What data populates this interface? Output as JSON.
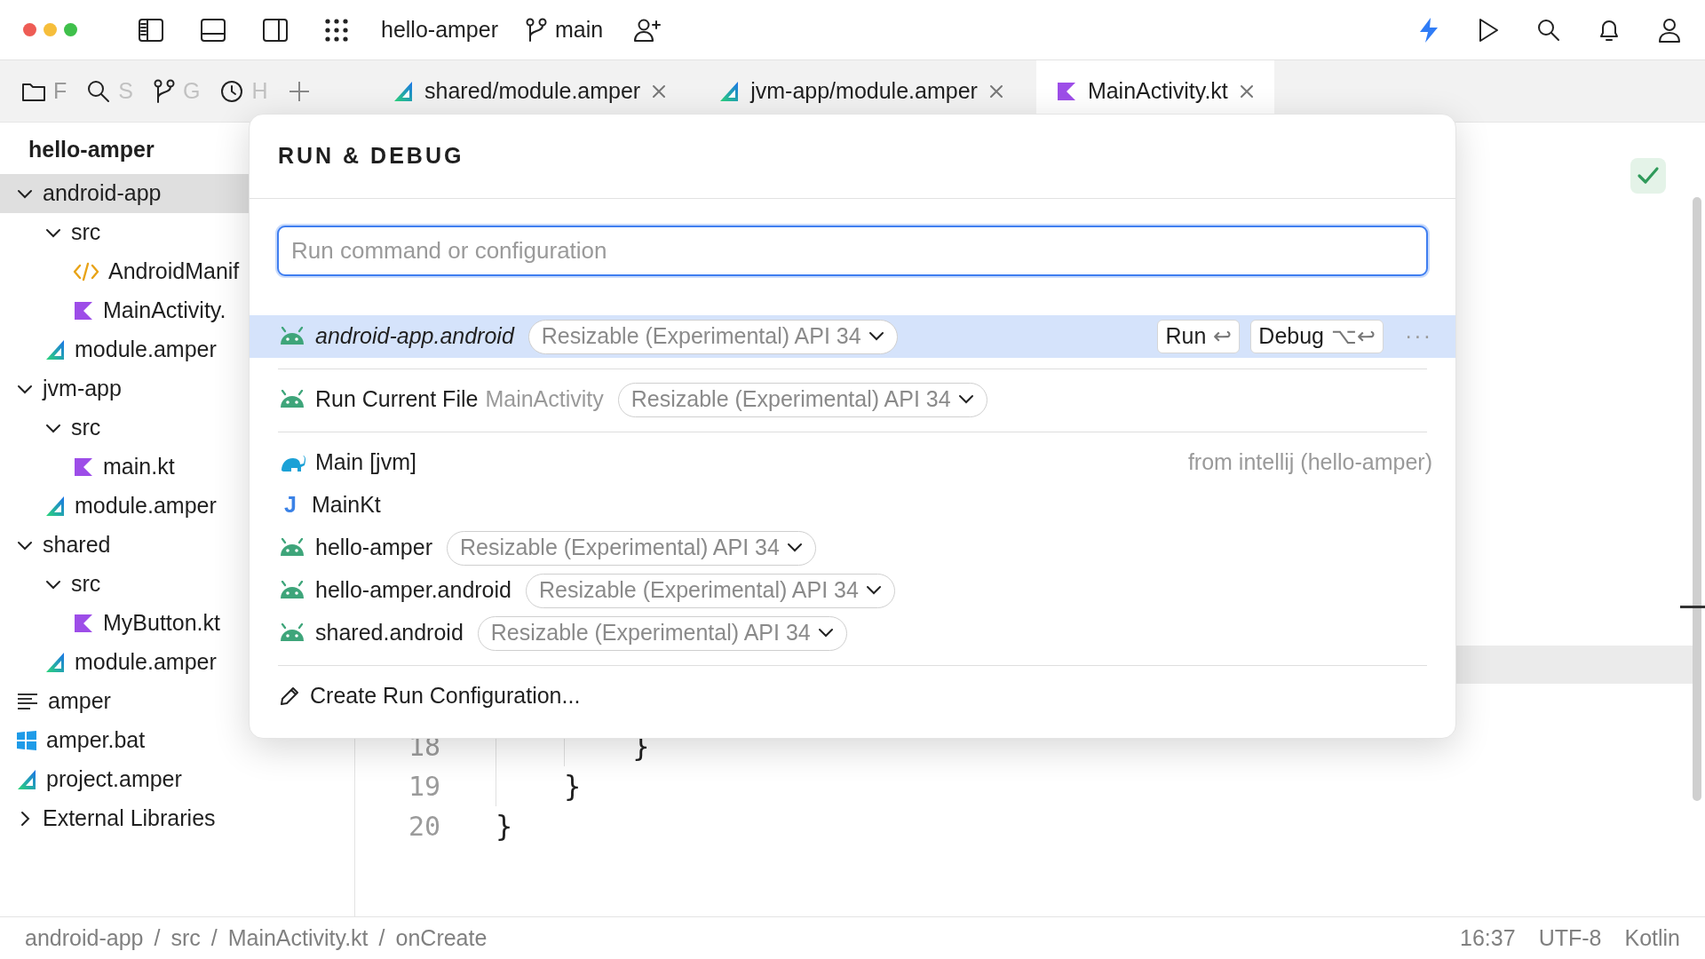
{
  "window": {
    "project": "hello-amper",
    "branch": "main"
  },
  "tool_tabs": [
    {
      "kind": "folder",
      "label": "F"
    },
    {
      "kind": "search",
      "label": "S"
    },
    {
      "kind": "branch",
      "label": "G"
    },
    {
      "kind": "clock",
      "label": "H"
    }
  ],
  "editor_tabs": [
    {
      "label": "shared/module.amper",
      "kind": "amper",
      "selected": false
    },
    {
      "label": "jvm-app/module.amper",
      "kind": "amper",
      "selected": false
    },
    {
      "label": "MainActivity.kt",
      "kind": "kotlin",
      "selected": true
    }
  ],
  "project": {
    "title": "hello-amper",
    "tree": [
      {
        "label": "android-app",
        "kind": "folder",
        "expanded": true,
        "selected": true,
        "children": [
          {
            "label": "src",
            "kind": "folder",
            "expanded": true,
            "selected": false,
            "children": [
              {
                "label": "AndroidManif",
                "kind": "xml",
                "selected": false
              },
              {
                "label": "MainActivity.",
                "kind": "kotlin",
                "selected": false
              }
            ]
          },
          {
            "label": "module.amper",
            "kind": "amper",
            "selected": false
          }
        ]
      },
      {
        "label": "jvm-app",
        "kind": "folder",
        "expanded": true,
        "selected": false,
        "children": [
          {
            "label": "src",
            "kind": "folder",
            "expanded": true,
            "selected": false,
            "children": [
              {
                "label": "main.kt",
                "kind": "kotlin",
                "selected": false
              }
            ]
          },
          {
            "label": "module.amper",
            "kind": "amper",
            "selected": false
          }
        ]
      },
      {
        "label": "shared",
        "kind": "folder",
        "expanded": true,
        "selected": false,
        "children": [
          {
            "label": "src",
            "kind": "folder",
            "expanded": true,
            "selected": false,
            "children": [
              {
                "label": "MyButton.kt",
                "kind": "kotlin",
                "selected": false
              }
            ]
          },
          {
            "label": "module.amper",
            "kind": "amper",
            "selected": false
          }
        ]
      },
      {
        "label": "amper",
        "kind": "script",
        "selected": false
      },
      {
        "label": "amper.bat",
        "kind": "windows",
        "selected": false
      },
      {
        "label": "project.amper",
        "kind": "amper",
        "selected": false
      },
      {
        "label": "External Libraries",
        "kind": "folder",
        "expanded": false,
        "selected": false
      }
    ]
  },
  "editor": {
    "lines": [
      {
        "number": "18",
        "text": "        }"
      },
      {
        "number": "19",
        "text": "    }"
      },
      {
        "number": "20",
        "text": "}"
      }
    ]
  },
  "popup": {
    "title": "RUN & DEBUG",
    "search": {
      "placeholder": "Run command or configuration"
    },
    "groups": [
      [
        {
          "kind": "android",
          "name": "android-app.android",
          "selected": true,
          "device": "Resizable (Experimental) API 34",
          "actions": [
            {
              "label": "Run",
              "shortcut": "↩"
            },
            {
              "label": "Debug",
              "shortcut": "⌥↩"
            }
          ],
          "more": "···"
        }
      ],
      [
        {
          "kind": "android",
          "name": "Run Current File",
          "detail": "MainActivity",
          "selected": false,
          "device": "Resizable (Experimental) API 34"
        }
      ],
      [
        {
          "kind": "gradle",
          "name": "Main [jvm]",
          "selected": false,
          "source": "from intellij (hello-amper)"
        },
        {
          "kind": "java",
          "badge": "J",
          "name": "MainKt",
          "selected": false
        },
        {
          "kind": "android",
          "name": "hello-amper",
          "selected": false,
          "device": "Resizable (Experimental) API 34"
        },
        {
          "kind": "android",
          "name": "hello-amper.android",
          "selected": false,
          "device": "Resizable (Experimental) API 34"
        },
        {
          "kind": "android",
          "name": "shared.android",
          "selected": false,
          "device": "Resizable (Experimental) API 34"
        }
      ]
    ],
    "footer": "Create Run Configuration..."
  },
  "status_bar": {
    "separator": "/",
    "breadcrumbs": [
      "android-app",
      "src",
      "MainActivity.kt",
      "onCreate"
    ],
    "right": [
      "16:37",
      "UTF-8",
      "Kotlin"
    ]
  }
}
